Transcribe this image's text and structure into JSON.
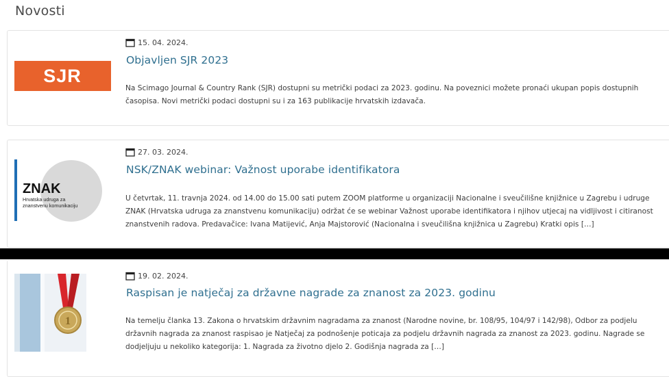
{
  "section": {
    "title": "Novosti"
  },
  "news": [
    {
      "date": "15. 04. 2024.",
      "title": "Objavljen SJR 2023",
      "excerpt_lines": [
        "Na Scimago Journal & Country  Rank (SJR) dostupni su metrički podaci za 2023. godinu.  Na poveznici možete pronaći ukupan popis dostupnih",
        "časopisa.  Novi metrički podaci dostupni su i za 163 publikacije hrvatskih izdavača."
      ],
      "thumb": {
        "text": "SJR",
        "color": "#e8622c"
      }
    },
    {
      "date": "27. 03. 2024.",
      "title": "NSK/ZNAK webinar: Važnost uporabe identifikatora",
      "excerpt_lines": [
        "U četvrtak, 11. travnja 2024. od 14.00 do 15.00 sati putem ZOOM platforme u organizaciji  Nacionalne i sveučilišne knjižnice u Zagrebu i udruge",
        "ZNAK (Hrvatska udruga za znanstvenu komunikaciju) održat će se webinar Važnost uporabe identifikatora i njihov utjecaj na vidljivost i citiranost",
        "znanstvenih radova.  Predavačice:  Ivana  Matijević, Anja  Majstorović (Nacionalna i sveučilišna knjižnica u Zagrebu)  Kratki opis […]"
      ],
      "thumb": {
        "logo_text": "ZNAK",
        "sub_line1": "Hrvatska udruga za",
        "sub_line2": "znanstvenu komunikaciju",
        "accent": "#1f6fb5"
      }
    },
    {
      "date": "19. 02. 2024.",
      "title": "Raspisan je natječaj za državne nagrade za znanost za 2023. godinu",
      "excerpt_lines": [
        "Na temelju članka 13. Zakona o hrvatskim državnim nagradama za znanost (Narodne novine, br. 108/95, 104/97 i 142/98), Odbor za podjelu",
        "državnih nagrada za znanost raspisao je  Natječaj za podnošenje poticaja za podjelu državnih nagrada za znanost za 2023. godinu.  Nagrade se",
        "dodjeljuju u nekoliko kategorija: 1.  Nagrada za životno djelo  2. Godišnja nagrada za […]"
      ],
      "thumb": {
        "ribbon_color": "#d8262c"
      }
    }
  ],
  "icons": {
    "date": "calendar-icon"
  },
  "colors": {
    "headline": "#2f6f8f",
    "border": "#e3e3e3"
  }
}
